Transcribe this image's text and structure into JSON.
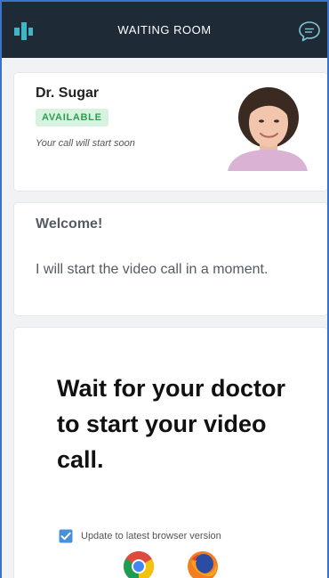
{
  "header": {
    "title": "WAITING ROOM",
    "logo_icon": "app-logo-icon",
    "chat_icon": "chat-bubble-icon",
    "background": "#1f2a37"
  },
  "doctor": {
    "name": "Dr. Sugar",
    "status": "AVAILABLE",
    "status_color": "#2e9e54",
    "status_note": "Your call will start soon",
    "avatar_icon": "doctor-photo"
  },
  "welcome": {
    "title": "Welcome!",
    "message": "I will start the video call in a moment."
  },
  "waiting": {
    "headline": "Wait for your doctor to start your video call.",
    "update_label": "Update to latest browser version",
    "update_checked": true,
    "browsers": [
      "chrome-icon",
      "firefox-icon"
    ]
  },
  "colors": {
    "accent": "#3fb6c6",
    "frame_border": "#3a73c9",
    "check": "#4a90d9"
  }
}
